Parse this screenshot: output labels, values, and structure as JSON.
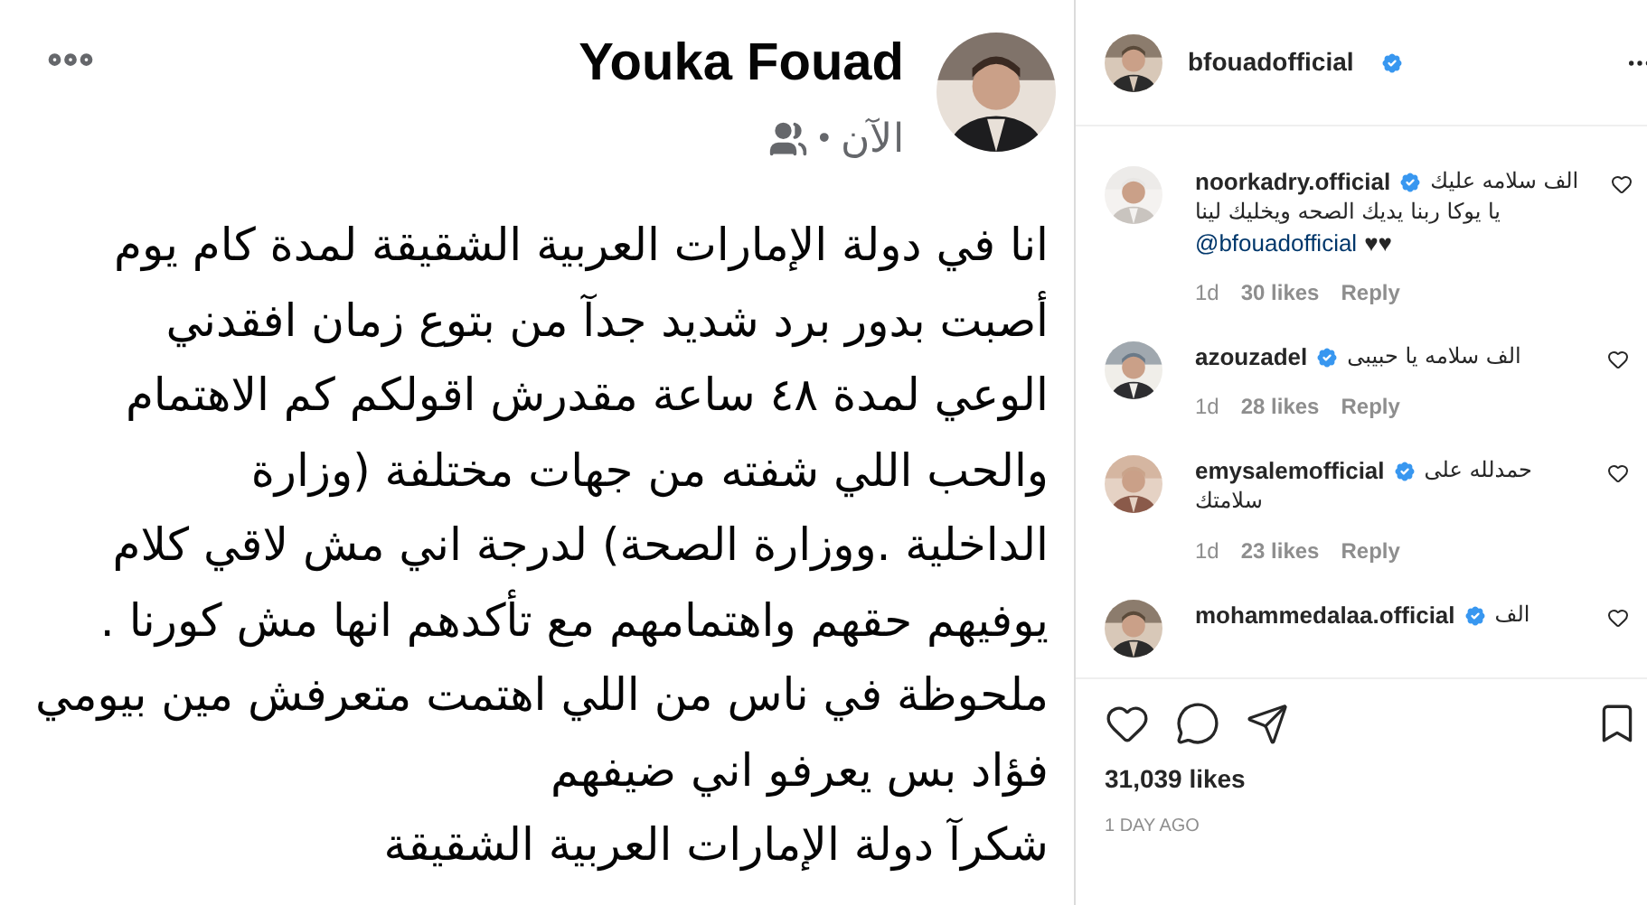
{
  "post": {
    "author": "Youka Fouad",
    "time": "الآن",
    "separator": "•",
    "lines": [
      "انا في دولة الإمارات العربية الشقيقة لمدة كام يوم",
      "أصبت بدور برد شديد جدآ من بتوع زمان افقدني",
      "الوعي لمدة ٤٨ ساعة مقدرش اقولكم كم الاهتمام",
      "والحب اللي شفته  من جهات مختلفة (وزارة",
      "الداخلية .ووزارة الصحة)  لدرجة اني مش لاقي كلام",
      "يوفيهم  حقهم واهتمامهم مع تأكدهم انها مش كورنا .",
      "ملحوظة في ناس من اللي اهتمت متعرفش مين بيومي",
      "فؤاد بس يعرفو اني ضيفهم",
      "شكرآ دولة الإمارات العربية الشقيقة"
    ]
  },
  "header": {
    "username": "bfouadofficial",
    "verified": true
  },
  "comments": [
    {
      "username": "noorkadry.official",
      "verified": true,
      "text": [
        "الف سلامه عليك",
        "يا يوكا ربنا يديك الصحه ويخليك لينا"
      ],
      "mention": "@bfouadofficial",
      "hearts": "♥♥",
      "age": "1d",
      "likes": "30 likes",
      "reply": "Reply"
    },
    {
      "username": "azouzadel",
      "verified": true,
      "text": [
        "الف سلامه يا حبيبى"
      ],
      "age": "1d",
      "likes": "28 likes",
      "reply": "Reply"
    },
    {
      "username": "emysalemofficial",
      "verified": true,
      "text": [
        "حمدلله على",
        "سلامتك"
      ],
      "age": "1d",
      "likes": "23 likes",
      "reply": "Reply"
    },
    {
      "username": "mohammedalaa.official",
      "verified": true,
      "text": [
        "الف"
      ]
    }
  ],
  "likes": "31,039 likes",
  "posted": "1 DAY AGO"
}
